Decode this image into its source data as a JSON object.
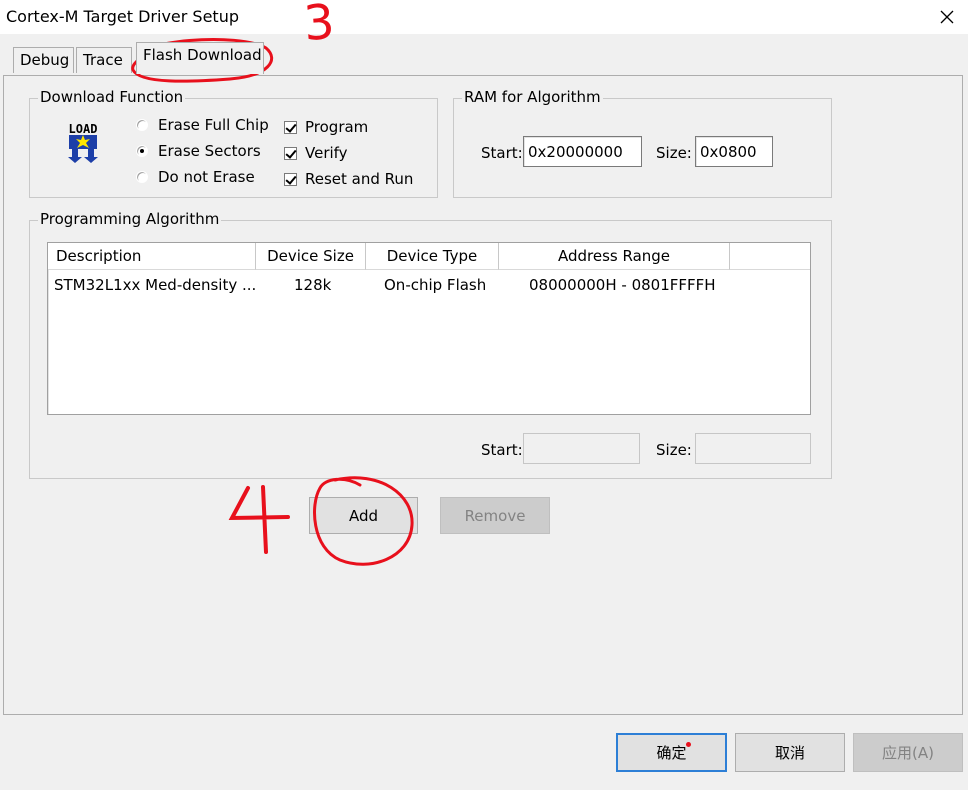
{
  "window": {
    "title": "Cortex-M Target Driver Setup",
    "close_glyph": "✕"
  },
  "tabs": [
    {
      "label": "Debug"
    },
    {
      "label": "Trace"
    },
    {
      "label": "Flash Download"
    }
  ],
  "download_function": {
    "title": "Download Function",
    "logo_text": "LOAD",
    "radios": [
      {
        "label": "Erase Full Chip",
        "checked": false
      },
      {
        "label": "Erase Sectors",
        "checked": true
      },
      {
        "label": "Do not Erase",
        "checked": false
      }
    ],
    "checks": [
      {
        "label": "Program",
        "checked": true
      },
      {
        "label": "Verify",
        "checked": true
      },
      {
        "label": "Reset and Run",
        "checked": true
      }
    ]
  },
  "ram_for_algorithm": {
    "title": "RAM for Algorithm",
    "start_label": "Start:",
    "start_value": "0x20000000",
    "size_label": "Size:",
    "size_value": "0x0800"
  },
  "programming_algorithm": {
    "title": "Programming Algorithm",
    "columns": [
      "Description",
      "Device Size",
      "Device Type",
      "Address Range"
    ],
    "rows": [
      {
        "description": "STM32L1xx Med-density ...",
        "device_size": "128k",
        "device_type": "On-chip Flash",
        "address_range": "08000000H - 0801FFFFH"
      }
    ],
    "start_label": "Start:",
    "start_value": "",
    "size_label": "Size:",
    "size_value": ""
  },
  "buttons": {
    "add": "Add",
    "remove": "Remove",
    "ok": "确定",
    "cancel": "取消",
    "apply": "应用(A)"
  },
  "annotations": {
    "step3": "3",
    "step4": "4",
    "color": "#e8101c"
  }
}
